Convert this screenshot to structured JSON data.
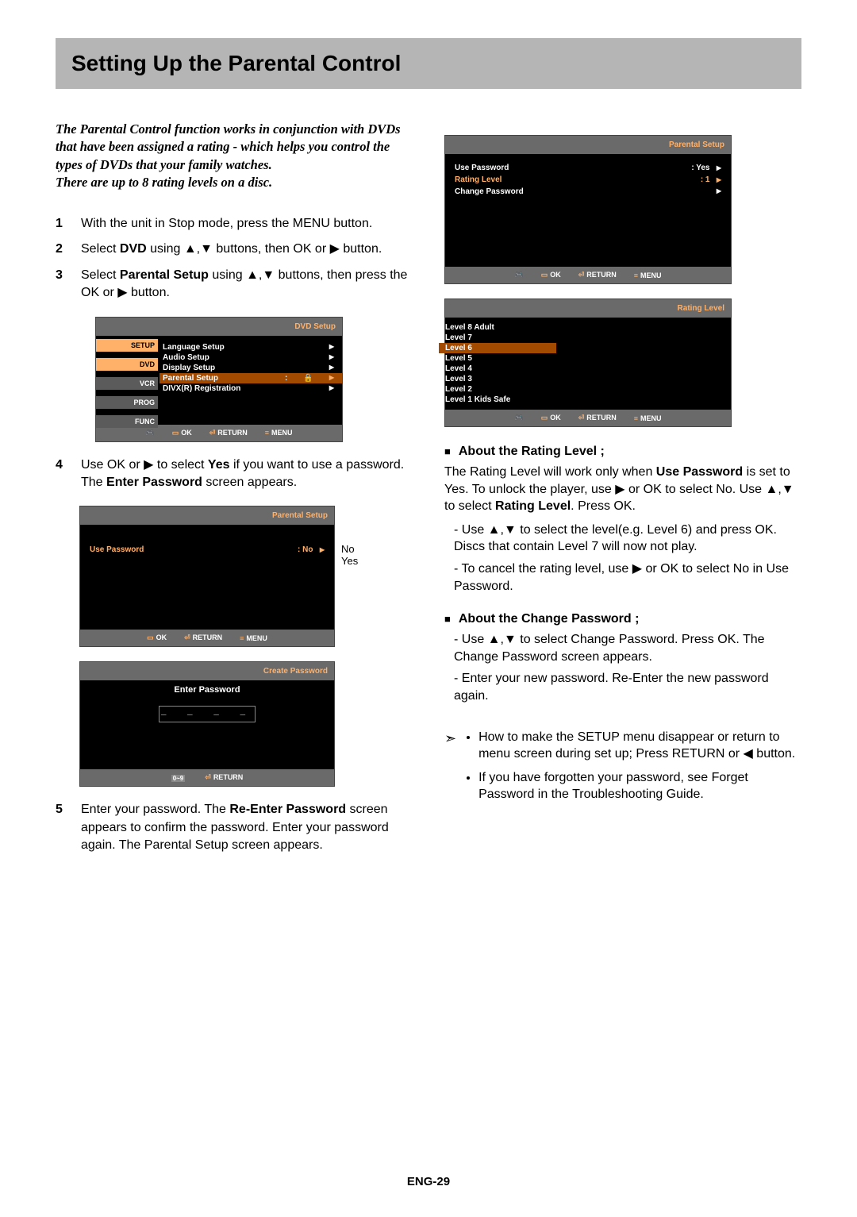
{
  "title": "Setting Up the Parental Control",
  "intro": "The Parental Control function works in conjunction with DVDs that have been assigned a rating - which helps you control the types of DVDs that your family watches.\nThere are up to 8 rating levels on a disc.",
  "steps": {
    "s1": "With the unit in Stop mode, press the MENU button.",
    "s2_a": "Select ",
    "s2_b": "DVD",
    "s2_c": " using ▲,▼ buttons, then OK or ▶ button.",
    "s3_a": "Select ",
    "s3_b": "Parental Setup",
    "s3_c": " using ▲,▼ buttons, then press the OK or ▶ button.",
    "s4_a": "Use OK or ▶ to select ",
    "s4_b": "Yes",
    "s4_c": " if you want to use a password. The ",
    "s4_d": "Enter Password",
    "s4_e": " screen appears.",
    "s5_a": "Enter your password. The ",
    "s5_b": "Re-Enter Password",
    "s5_c": " screen appears to confirm the password. Enter your password again. The Parental Setup screen appears."
  },
  "nums": {
    "n1": "1",
    "n2": "2",
    "n3": "3",
    "n4": "4",
    "n5": "5"
  },
  "osd1": {
    "title": "DVD Setup",
    "tabs": [
      "SETUP",
      "DVD",
      "VCR",
      "PROG",
      "FUNC"
    ],
    "items": [
      {
        "label": "Language Setup",
        "hi": false
      },
      {
        "label": "Audio Setup",
        "hi": false
      },
      {
        "label": "Display Setup",
        "hi": false
      },
      {
        "label": "Parental Setup",
        "hi": true,
        "val": ":"
      },
      {
        "label": "DIVX(R) Registration",
        "hi": false
      }
    ],
    "ftr": {
      "ok": "OK",
      "ret": "RETURN",
      "menu": "MENU"
    }
  },
  "osd2": {
    "title": "Parental Setup",
    "row": {
      "label": "Use Password",
      "val": ": No"
    },
    "callout": {
      "no": "No",
      "yes": "Yes"
    },
    "ftr": {
      "ok": "OK",
      "ret": "RETURN",
      "menu": "MENU"
    }
  },
  "osd3": {
    "title": "Create Password",
    "label": "Enter Password",
    "dashes": "– – – –",
    "ftr": {
      "num": "0 ~ 9",
      "ret": "RETURN"
    }
  },
  "osd4": {
    "title": "Parental Setup",
    "rows": [
      {
        "label": "Use Password",
        "val": ":   Yes",
        "hi": false,
        "arrow": true
      },
      {
        "label": "Rating Level",
        "val": ":    1",
        "hi": true,
        "arrow": true
      },
      {
        "label": "Change Password",
        "val": "",
        "hi": false,
        "arrow": true
      }
    ],
    "ftr": {
      "ok": "OK",
      "ret": "RETURN",
      "menu": "MENU"
    }
  },
  "osd5": {
    "title": "Rating Level",
    "rows": [
      "Level  8  Adult",
      "Level  7",
      "Level  6",
      "Level  5",
      "Level  4",
      "Level  3",
      "Level  2",
      "Level  1 Kids Safe"
    ],
    "hi_index": 2,
    "ftr": {
      "ok": "OK",
      "ret": "RETURN",
      "menu": "MENU"
    }
  },
  "right": {
    "about_rating_head": "About the Rating Level ;",
    "about_rating_p1_a": "The Rating Level will work only when ",
    "about_rating_p1_b": "Use Password",
    "about_rating_p1_c": " is set to Yes. To unlock the player, use ▶ or OK to select No. Use ▲,▼ to select ",
    "about_rating_p1_d": "Rating Level",
    "about_rating_p1_e": ". Press OK.",
    "about_rating_d1": "Use ▲,▼ to select the level(e.g. Level 6) and press OK. Discs that contain Level 7 will now  not play.",
    "about_rating_d2": "To cancel the rating level, use ▶ or OK to select No in Use Password.",
    "about_change_head": "About the Change Password ;",
    "about_change_d1": "Use ▲,▼ to select Change Password. Press OK. The Change Password screen appears.",
    "about_change_d2": "Enter your new password. Re-Enter the new password again.",
    "tip1": "How to make the SETUP menu disappear or return to menu screen during set up; Press RETURN or ◀ button.",
    "tip2": "If you have forgotten your password, see Forget Password in the Troubleshooting Guide."
  },
  "page_num": "ENG-29"
}
